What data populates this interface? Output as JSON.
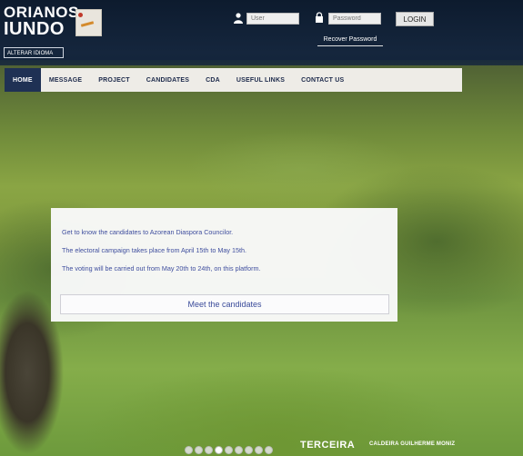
{
  "brand": {
    "line1": "ORIANOS",
    "line2": "IUNDO"
  },
  "header": {
    "language_button": "ALTERAR IDIOMA",
    "user_placeholder": "User",
    "password_placeholder": "Password",
    "login_label": "LOGIN",
    "recover_label": "Recover Password"
  },
  "nav": {
    "items": [
      {
        "label": "HOME"
      },
      {
        "label": "MESSAGE"
      },
      {
        "label": "PROJECT"
      },
      {
        "label": "CANDIDATES"
      },
      {
        "label": "CDA"
      },
      {
        "label": "USEFUL LINKS"
      },
      {
        "label": "CONTACT US"
      }
    ],
    "active": "HOME"
  },
  "panel": {
    "line1": "Get to know the candidates to Azorean Diaspora Councilor.",
    "line2": "The electoral campaign takes place from April 15th to May 15th.",
    "line3": "The voting will be carried out from May 20th to 24th, on this platform.",
    "button": "Meet the candidates"
  },
  "slider": {
    "dot_count": 9,
    "active_index": 3
  },
  "caption": {
    "title": "TERCEIRA",
    "subtitle": "CALDEIRA GUILHERME MONIZ"
  },
  "colors": {
    "header_bg": "#0d1b2e",
    "nav_active": "#1f3154",
    "panel_text": "#3f4e9e"
  },
  "icons": [
    "user-icon",
    "lock-icon"
  ]
}
